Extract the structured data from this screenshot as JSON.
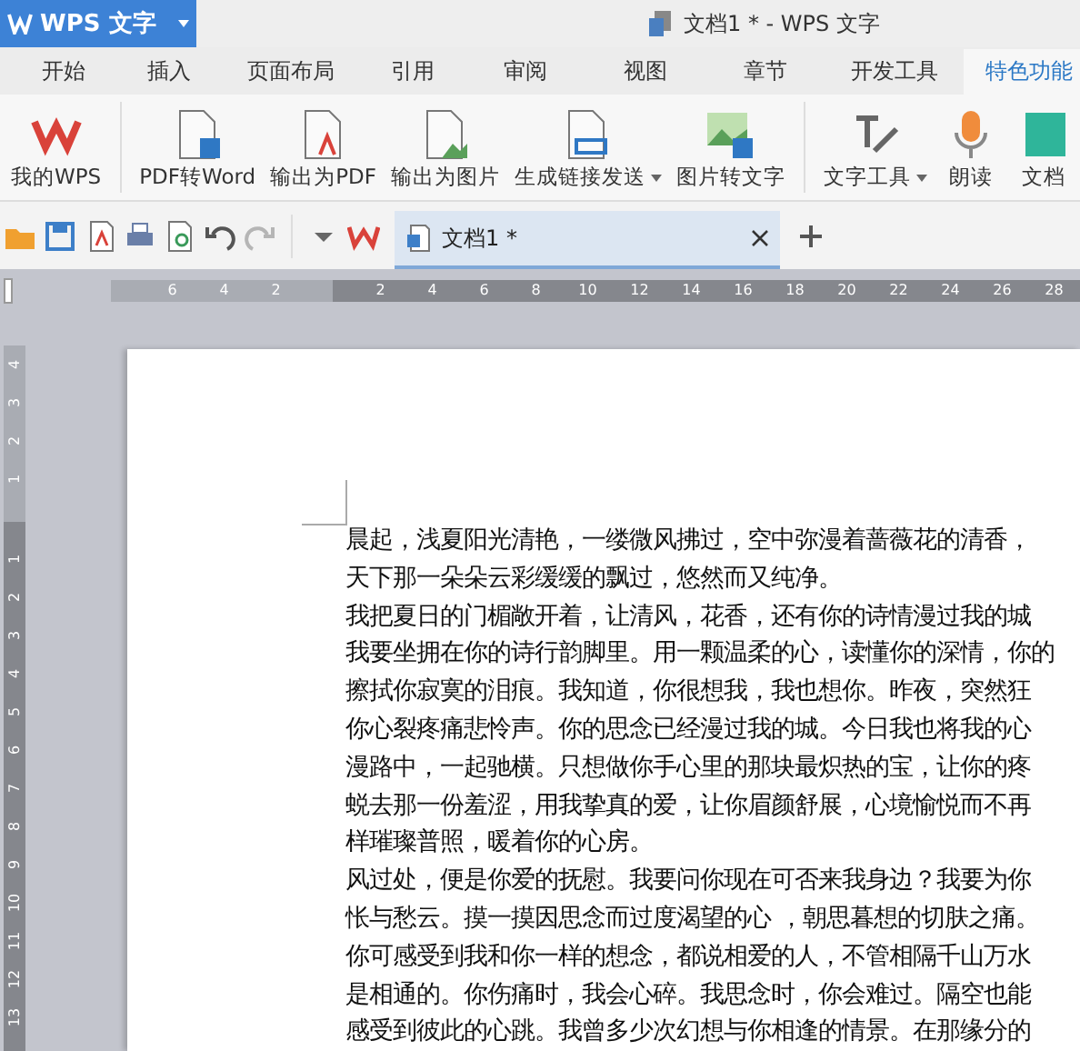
{
  "title_bar": {
    "app_button": "WPS 文字",
    "title": "文档1 * - WPS 文字"
  },
  "menu_tabs": [
    {
      "label": "开始",
      "selected": false
    },
    {
      "label": "插入",
      "selected": false
    },
    {
      "label": "页面布局",
      "selected": false
    },
    {
      "label": "引用",
      "selected": false
    },
    {
      "label": "审阅",
      "selected": false
    },
    {
      "label": "视图",
      "selected": false
    },
    {
      "label": "章节",
      "selected": false
    },
    {
      "label": "开发工具",
      "selected": false
    },
    {
      "label": "特色功能",
      "selected": true
    }
  ],
  "ribbon": [
    {
      "label": "我的WPS",
      "kind": "wps"
    },
    {
      "kind": "separator"
    },
    {
      "label": "PDF转Word",
      "kind": "pdf-word"
    },
    {
      "label": "输出为PDF",
      "kind": "to-pdf"
    },
    {
      "label": "输出为图片",
      "kind": "to-image"
    },
    {
      "label": "生成链接发送",
      "kind": "link",
      "dropdown": true
    },
    {
      "label": "图片转文字",
      "kind": "image-text"
    },
    {
      "kind": "separator"
    },
    {
      "label": "文字工具",
      "kind": "text-tool",
      "dropdown": true
    },
    {
      "label": "朗读",
      "kind": "mic"
    },
    {
      "label": "文档",
      "kind": "doc"
    }
  ],
  "quick_access": {
    "redo_disabled": true
  },
  "document_tab": {
    "title": "文档1 *",
    "selected": true
  },
  "ruler": {
    "left_numbers": [
      "6",
      "4",
      "2"
    ],
    "right_numbers": [
      "2",
      "4",
      "6",
      "8",
      "10",
      "12",
      "14",
      "16",
      "18",
      "20",
      "22",
      "24",
      "26",
      "28"
    ]
  },
  "vertical_ruler": {
    "top_numbers": [
      "4",
      "3",
      "2",
      "1"
    ],
    "bottom_numbers": [
      "1",
      "2",
      "3",
      "4",
      "5",
      "6",
      "7",
      "8",
      "9",
      "10",
      "11",
      "12",
      "13"
    ]
  },
  "document": {
    "lines": [
      "晨起，浅夏阳光清艳，一缕微风拂过，空中弥漫着蔷薇花的清香，",
      "天下那一朵朵云彩缓缓的飘过，悠然而又纯净。",
      "我把夏日的门楣敞开着，让清风，花香，还有你的诗情漫过我的城",
      "我要坐拥在你的诗行韵脚里。用一颗温柔的心，读懂你的深情，你的",
      "擦拭你寂寞的泪痕。我知道，你很想我，我也想你。昨夜，突然狂",
      "你心裂疼痛悲怜声。你的思念已经漫过我的城。今日我也将我的心",
      "漫路中，一起驰横。只想做你手心里的那块最炽热的宝，让你的疼",
      "蜕去那一份羞涩，用我挚真的爱，让你眉颜舒展，心境愉悦而不再",
      "样璀璨普照，暖着你的心房。",
      "风过处，便是你爱的抚慰。我要问你现在可否来我身边？我要为你",
      "怅与愁云。摸一摸因思念而过度渴望的心 ，朝思暮想的切肤之痛。",
      "你可感受到我和你一样的想念，都说相爱的人，不管相隔千山万水",
      "是相通的。你伤痛时，我会心碎。我思念时，你会难过。隔空也能",
      "感受到彼此的心跳。我曾多少次幻想与你相逢的情景。在那缘分的"
    ]
  }
}
